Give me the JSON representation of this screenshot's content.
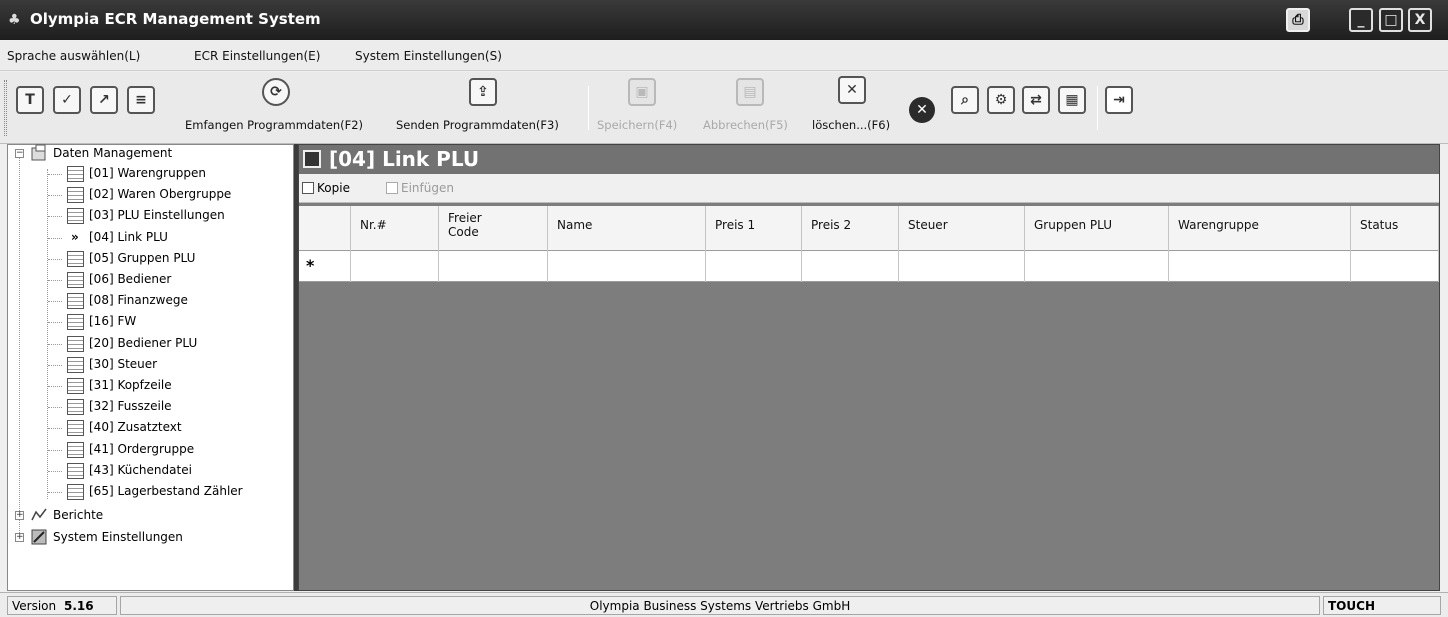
{
  "window": {
    "title": "Olympia ECR Management System",
    "buttons": {
      "minimize": "_",
      "maximize": "□",
      "close": "X"
    }
  },
  "menubar": {
    "items": [
      "Sprache auswählen(L)",
      "ECR Einstellungen(E)",
      "System Einstellungen(S)"
    ]
  },
  "toolbar": {
    "receive_label": "Emfangen Programmdaten(F2)",
    "send_label": "Senden Programmdaten(F3)",
    "save_label": "Speichern(F4)",
    "cancel_label": "Abbrechen(F5)",
    "delete_label": "löschen...(F6)",
    "save_enabled": false,
    "cancel_enabled": false
  },
  "tree": {
    "root_data_mgmt": "Daten Management",
    "items": [
      "[01] Warengruppen",
      "[02] Waren Obergruppe",
      "[03] PLU Einstellungen",
      "[04] Link PLU",
      "[05] Gruppen PLU",
      "[06] Bediener",
      "[08] Finanzwege",
      "[16] FW",
      "[20] Bediener PLU",
      "[30] Steuer",
      "[31] Kopfzeile",
      "[32] Fusszeile",
      "[40] Zusatztext",
      "[41] Ordergruppe",
      "[43] Küchendatei",
      "[65] Lagerbestand Zähler"
    ],
    "selected_marker": "»",
    "selected_index": 3,
    "root_reports": "Berichte",
    "root_system": "System Einstellungen"
  },
  "content": {
    "title": "[04] Link PLU",
    "copy_label": "Kopie",
    "paste_label": "Einfügen",
    "paste_enabled": false,
    "columns": [
      {
        "line1": "Nr.#",
        "line2": ""
      },
      {
        "line1": "Freier",
        "line2": "Code"
      },
      {
        "line1": "Name",
        "line2": ""
      },
      {
        "line1": "Preis 1",
        "line2": ""
      },
      {
        "line1": "Preis 2",
        "line2": ""
      },
      {
        "line1": "Steuer",
        "line2": ""
      },
      {
        "line1": "Gruppen PLU",
        "line2": ""
      },
      {
        "line1": "Warengruppe",
        "line2": ""
      },
      {
        "line1": "Status",
        "line2": ""
      }
    ],
    "new_row_marker": "*"
  },
  "statusbar": {
    "version_label": "Version",
    "version_value": "5.16",
    "company": "Olympia Business Systems Vertriebs GmbH",
    "mode": "TOUCH"
  }
}
